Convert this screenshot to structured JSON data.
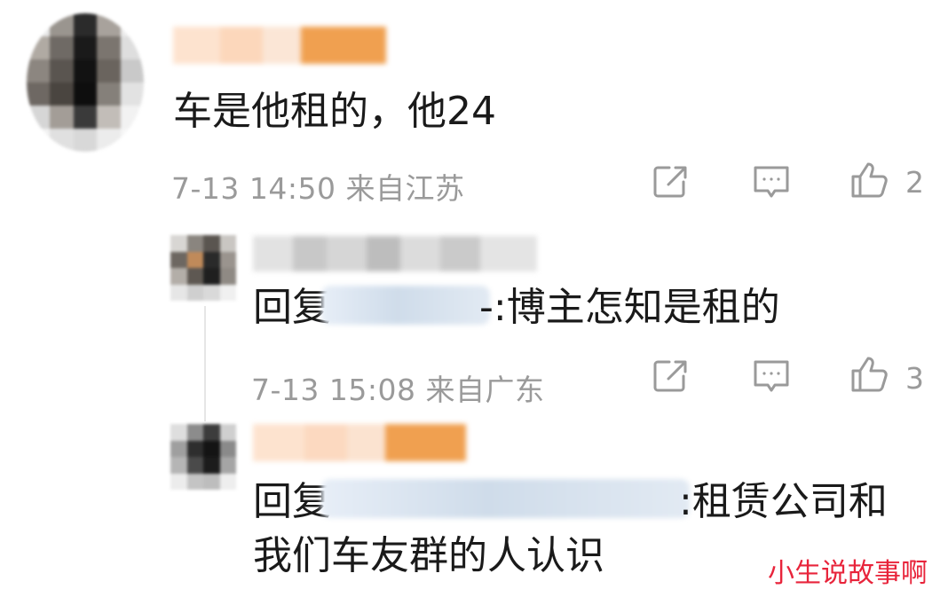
{
  "comment": {
    "text": "车是他租的，他24",
    "meta": "7-13 14:50 来自江苏",
    "like_count": "2",
    "icons": [
      "share-icon",
      "reply-icon",
      "like-icon"
    ]
  },
  "replies": [
    {
      "reply_prefix": "回复",
      "text": "-:博主怎知是租的",
      "meta": "7-13 15:08 来自广东",
      "like_count": "3",
      "icons": [
        "share-icon",
        "reply-icon",
        "like-icon"
      ]
    },
    {
      "reply_prefix": "回复",
      "text_line1": ":租赁公司和",
      "text_line2": "我们车友群的人认识"
    }
  ],
  "watermark": "小生说故事啊",
  "colors": {
    "meta_gray": "#9a9a9a",
    "watermark_red": "#e8243b",
    "mosaic_orange": "#f0a050"
  }
}
